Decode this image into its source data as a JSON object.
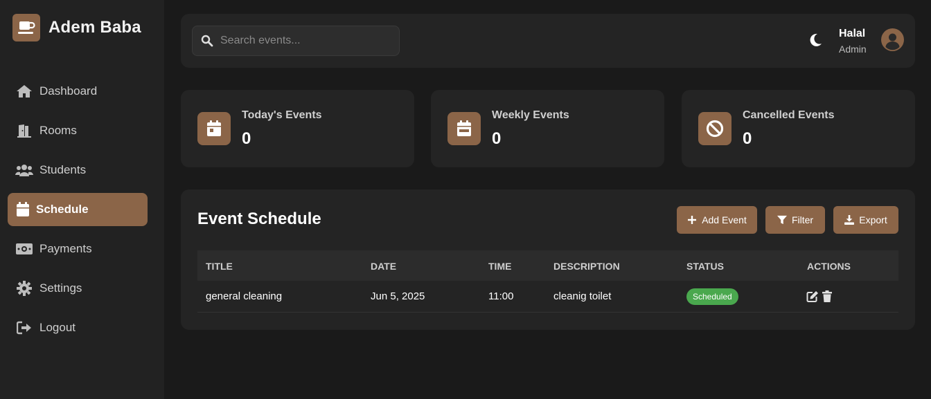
{
  "brand": {
    "name": "Adem Baba",
    "logo_icon": "coffee-cup-icon"
  },
  "sidebar": {
    "items": [
      {
        "label": "Dashboard",
        "icon": "home-icon"
      },
      {
        "label": "Rooms",
        "icon": "door-icon"
      },
      {
        "label": "Students",
        "icon": "users-icon"
      },
      {
        "label": "Schedule",
        "icon": "calendar-icon",
        "active": true
      },
      {
        "label": "Payments",
        "icon": "money-icon"
      },
      {
        "label": "Settings",
        "icon": "gear-icon"
      },
      {
        "label": "Logout",
        "icon": "logout-icon"
      }
    ]
  },
  "header": {
    "search": {
      "placeholder": "Search events...",
      "value": ""
    },
    "user": {
      "name": "Halal",
      "role": "Admin"
    }
  },
  "stats": [
    {
      "title": "Today's Events",
      "value": "0",
      "icon": "calendar-day-icon"
    },
    {
      "title": "Weekly Events",
      "value": "0",
      "icon": "calendar-week-icon"
    },
    {
      "title": "Cancelled Events",
      "value": "0",
      "icon": "ban-icon"
    }
  ],
  "schedule": {
    "title": "Event Schedule",
    "buttons": {
      "add": "Add Event",
      "filter": "Filter",
      "export": "Export"
    },
    "columns": [
      "TITLE",
      "DATE",
      "TIME",
      "DESCRIPTION",
      "STATUS",
      "ACTIONS"
    ],
    "rows": [
      {
        "title": "general cleaning",
        "date": "Jun 5, 2025",
        "time": "11:00",
        "description": "cleanig toilet",
        "status": "Scheduled"
      }
    ]
  },
  "colors": {
    "accent": "#8b6548",
    "background": "#1a1a1a",
    "card": "#242424",
    "status_scheduled": "#4aa84e"
  }
}
